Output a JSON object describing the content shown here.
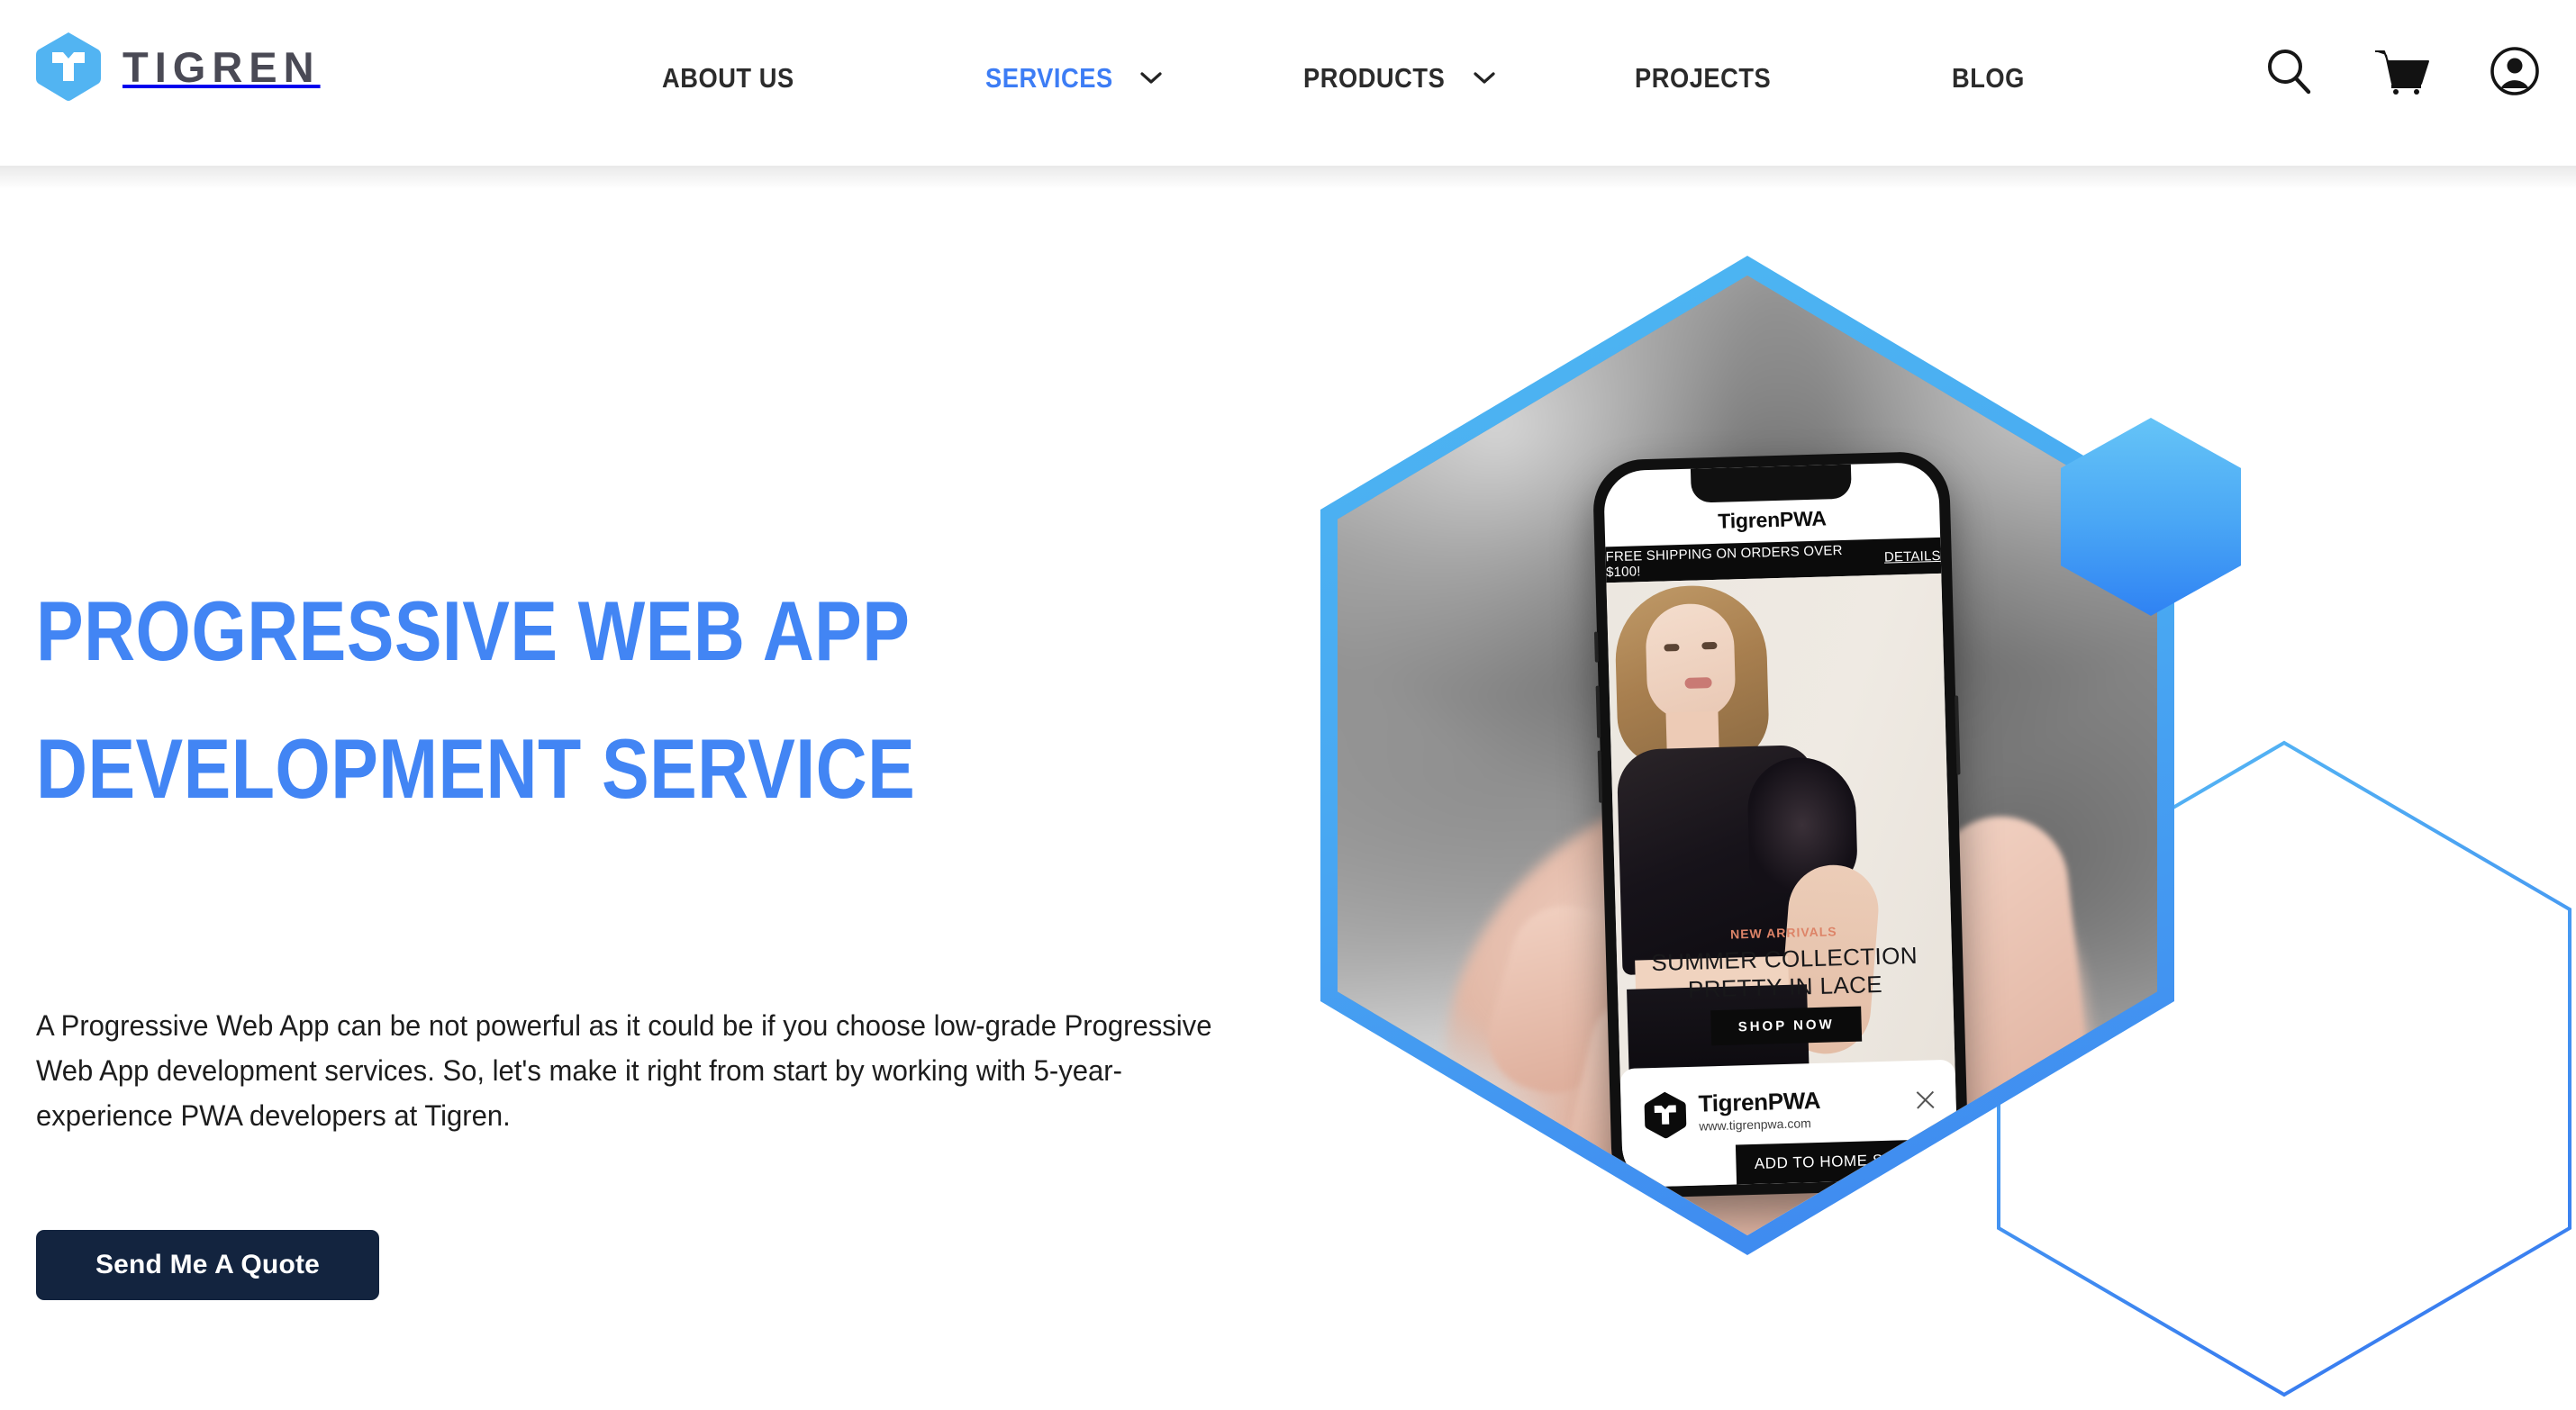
{
  "brand": {
    "name": "TIGREN",
    "logo_icon": "tigren-hexagon-logo",
    "accent_blue": "#4285f4",
    "logo_blue": "#4db4f0",
    "text_dark": "#4a4a55"
  },
  "nav": {
    "items": [
      {
        "label": "ABOUT US",
        "has_dropdown": false,
        "active": false
      },
      {
        "label": "SERVICES",
        "has_dropdown": true,
        "active": true
      },
      {
        "label": "PRODUCTS",
        "has_dropdown": true,
        "active": false
      },
      {
        "label": "PROJECTS",
        "has_dropdown": false,
        "active": false
      },
      {
        "label": "BLOG",
        "has_dropdown": false,
        "active": false
      }
    ],
    "icons": [
      {
        "name": "search-icon",
        "glyph": "magnifier"
      },
      {
        "name": "cart-icon",
        "glyph": "shopping-cart"
      },
      {
        "name": "account-icon",
        "glyph": "user-circle"
      }
    ]
  },
  "hero": {
    "title_line_1": "PROGRESSIVE WEB APP",
    "title_line_2": "DEVELOPMENT SERVICE",
    "body": "A Progressive Web App can be not powerful as it could be if you choose low-grade Progressive Web App development services. So, let's make it right from start by working with 5-year-experience PWA developers at Tigren.",
    "cta_label": "Send Me A Quote",
    "cta_bg": "#13243f"
  },
  "phone_mockup": {
    "store_name": "TigrenPWA",
    "shipping_banner": "FREE SHIPPING ON ORDERS OVER $100!",
    "shipping_link": "DETAILS",
    "eyebrow": "NEW ARRIVALS",
    "headline_line_1": "SUMMER COLLECTION",
    "headline_line_2": "PRETTY IN LACE",
    "shop_button": "SHOP NOW",
    "a2hs": {
      "app_name": "TigrenPWA",
      "url": "www.tigrenpwa.com",
      "button": "ADD TO HOME SCREEN",
      "close_icon": "close-icon"
    }
  },
  "decorations": {
    "hexagon_frame_color_top": "#4db7f2",
    "hexagon_frame_color_bottom": "#3d85f0",
    "gradient_hexagon_top": "#65c4f7",
    "gradient_hexagon_bottom": "#2f82f3",
    "outline_hexagon_color": "#3d85f0"
  }
}
